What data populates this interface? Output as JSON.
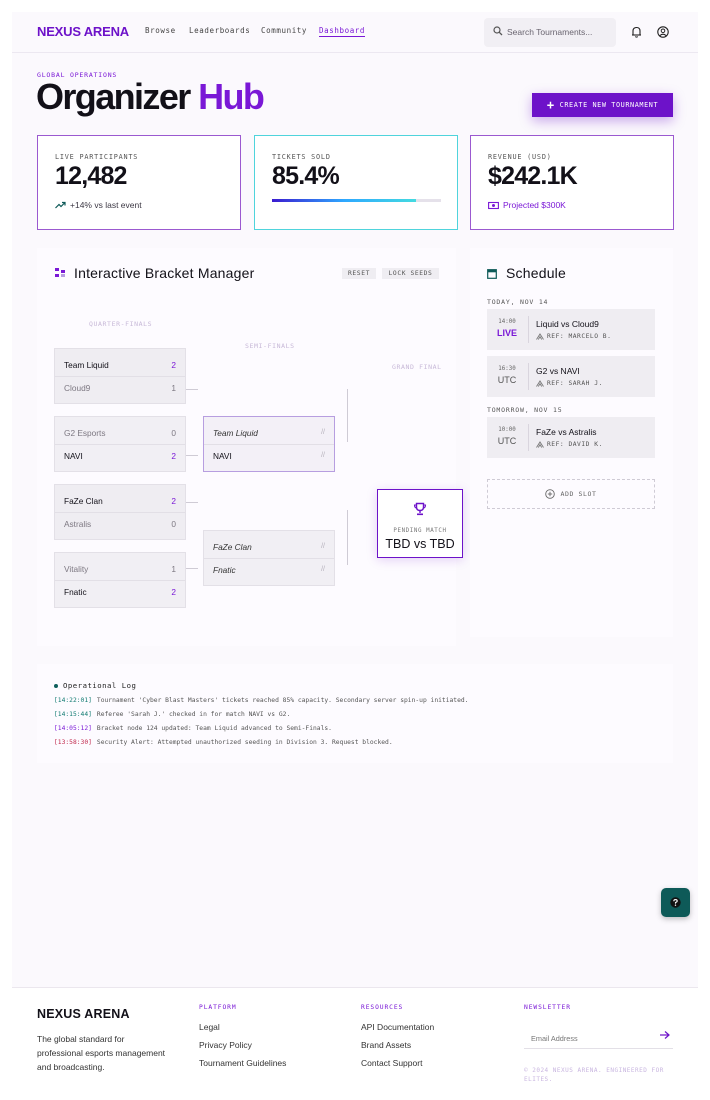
{
  "nav": {
    "logo": "NEXUS ARENA",
    "links": [
      "Browse",
      "Leaderboards",
      "Community",
      "Dashboard"
    ],
    "active": "Dashboard",
    "search_placeholder": "Search Tournaments..."
  },
  "header": {
    "eyebrow": "GLOBAL OPERATIONS",
    "title_main": "Organizer",
    "title_accent": "Hub",
    "cta_label": "CREATE NEW TOURNAMENT"
  },
  "stats": [
    {
      "label": "LIVE PARTICIPANTS",
      "value": "12,482",
      "sub": "+14% vs last event"
    },
    {
      "label": "TICKETS SOLD",
      "value": "85.4%",
      "progress": 0.854
    },
    {
      "label": "REVENUE (USD)",
      "value": "$242.1K",
      "sub": "Projected $300K"
    }
  ],
  "bracket": {
    "title": "Interactive Bracket Manager",
    "reset_label": "RESET",
    "lock_label": "LOCK SEEDS",
    "rounds": [
      "QUARTER-FINALS",
      "SEMI-FINALS",
      "GRAND FINAL"
    ],
    "quarterfinals": [
      {
        "team1": "Team Liquid",
        "score1": "2",
        "team2": "Cloud9",
        "score2": "1"
      },
      {
        "team1": "G2 Esports",
        "score1": "0",
        "team2": "NAVI",
        "score2": "2"
      },
      {
        "team1": "FaZe Clan",
        "score1": "2",
        "team2": "Astralis",
        "score2": "0"
      },
      {
        "team1": "Vitality",
        "score1": "1",
        "team2": "Fnatic",
        "score2": "2"
      }
    ],
    "semifinals": [
      {
        "team1": "Team Liquid",
        "score1": "//",
        "team2": "NAVI",
        "score2": "//"
      },
      {
        "team1": "FaZe Clan",
        "score1": "//",
        "team2": "Fnatic",
        "score2": "//"
      }
    ],
    "final": {
      "status": "PENDING MATCH",
      "label": "TBD vs TBD"
    }
  },
  "schedule": {
    "title": "Schedule",
    "days": [
      {
        "label": "TODAY, NOV 14",
        "slots": [
          {
            "time": "14:00",
            "zone": "LIVE",
            "match": "Liquid vs Cloud9",
            "ref": "REF: MARCELO B."
          },
          {
            "time": "16:30",
            "zone": "UTC",
            "match": "G2 vs NAVI",
            "ref": "REF: SARAH J."
          }
        ]
      },
      {
        "label": "TOMORROW, NOV 15",
        "slots": [
          {
            "time": "10:00",
            "zone": "UTC",
            "match": "FaZe vs Astralis",
            "ref": "REF: DAVID K."
          }
        ]
      }
    ],
    "add_label": "ADD SLOT"
  },
  "log": {
    "title": "Operational Log",
    "entries": [
      {
        "time": "[14:22:01]",
        "text": "Tournament 'Cyber Blast Masters' tickets reached 85% capacity. Secondary server spin-up initiated.",
        "color": "#0f7a70"
      },
      {
        "time": "[14:15:44]",
        "text": "Referee 'Sarah J.' checked in for match NAVI vs G2.",
        "color": "#0f7a70"
      },
      {
        "time": "[14:05:12]",
        "text": "Bracket node 124 updated: Team Liquid advanced to Semi-Finals.",
        "color": "#7a18d6"
      },
      {
        "time": "[13:58:30]",
        "text": "Security Alert: Attempted unauthorized seeding in Division 3. Request blocked.",
        "color": "#c0264a"
      }
    ]
  },
  "footer": {
    "logo": "NEXUS ARENA",
    "description": "The global standard for professional esports management and broadcasting.",
    "platform_head": "PLATFORM",
    "platform_links": [
      "Legal",
      "Privacy Policy",
      "Tournament Guidelines"
    ],
    "resources_head": "RESOURCES",
    "resources_links": [
      "API Documentation",
      "Brand Assets",
      "Contact Support"
    ],
    "newsletter_head": "NEWSLETTER",
    "email_placeholder": "Email Address",
    "copyright": "© 2024 NEXUS ARENA. ENGINEERED FOR ELITES."
  },
  "colors": {
    "accent": "#6d12c9",
    "teal": "#0e5a58",
    "cyan": "#4fd4dc"
  },
  "icons": [
    "search-icon",
    "bell-icon",
    "user-icon",
    "plus-icon",
    "trend-up-icon",
    "money-icon",
    "bracket-icon",
    "trophy-icon",
    "calendar-icon",
    "referee-icon",
    "add-circle-icon",
    "help-icon",
    "arrow-right-icon"
  ]
}
